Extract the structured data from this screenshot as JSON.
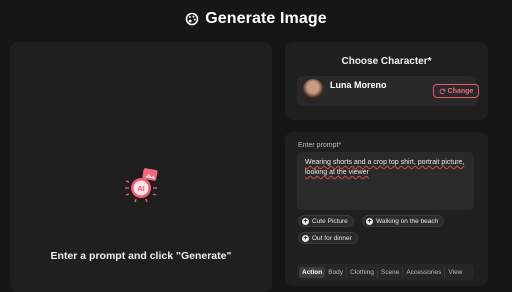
{
  "header": {
    "title": "Generate Image",
    "icon": "palette-icon"
  },
  "canvas": {
    "empty_message": "Enter a prompt and click \"Generate\"",
    "badge_text": "AI"
  },
  "character": {
    "title": "Choose Character*",
    "name": "Luna Moreno",
    "change_label": "Change"
  },
  "prompt": {
    "label": "Enter prompt*",
    "value": "Wearing shorts and a crop top shirt, portrait picture, looking at the viewer",
    "suggestions": [
      "Cute Picture",
      "Walking on the beach",
      "Out for dinner"
    ]
  },
  "tabs": [
    "Action",
    "Body",
    "Clothing",
    "Scene",
    "Accessories",
    "View"
  ],
  "active_tab": "Action",
  "colors": {
    "accent": "#e85a6b",
    "background": "#161616",
    "panel": "#1f1f1f"
  }
}
